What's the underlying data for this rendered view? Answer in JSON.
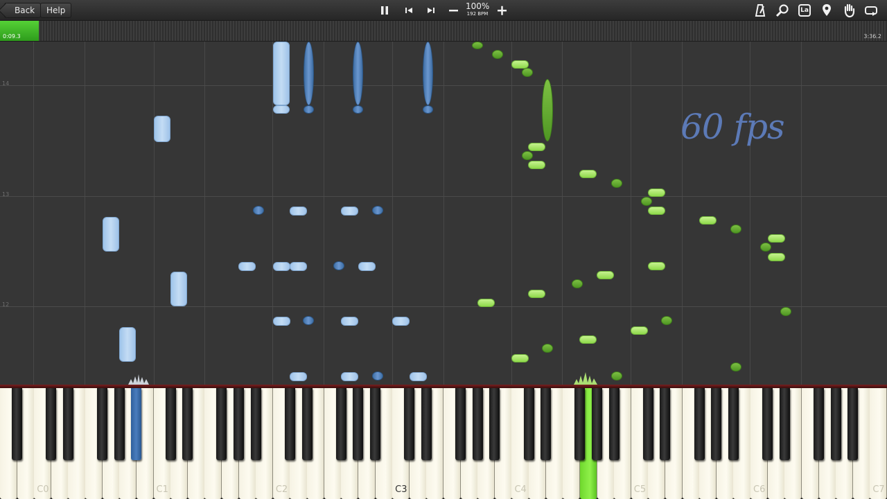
{
  "toolbar": {
    "back_label": "Back",
    "help_label": "Help",
    "speed_percent": "100%",
    "tempo": "192 BPM",
    "icons": [
      "pause-icon",
      "skip-back-icon",
      "skip-forward-icon",
      "minus-icon",
      "plus-icon",
      "metronome-icon",
      "search-icon",
      "label-icon",
      "location-pin-icon",
      "hand-icon",
      "loop-icon"
    ],
    "label_icon_text": "La"
  },
  "timeline": {
    "current_time": "0:09.3",
    "total_time": "3:36.2",
    "progress_fraction": 0.043,
    "progress_color": "#3dbf22"
  },
  "roll": {
    "measure_numbers": [
      "14",
      "13",
      "12"
    ],
    "overlay_text": "60 fps",
    "overlay_color": "#5c7ab7",
    "colors": {
      "left_hand_light": "#b3d2f1",
      "left_hand_dark": "#4a79b2",
      "right_hand_light": "#a9e86a",
      "right_hand_dark": "#5fa82e"
    }
  },
  "keyboard": {
    "octave_labels": [
      "C0",
      "C1",
      "C2",
      "C3",
      "C4",
      "C5",
      "C6",
      "C7"
    ],
    "active_keys": [
      {
        "key": "black",
        "hand": "left",
        "color": "#4a7dbd"
      },
      {
        "key": "white",
        "hand": "right",
        "color": "#7ee23a"
      }
    ]
  }
}
